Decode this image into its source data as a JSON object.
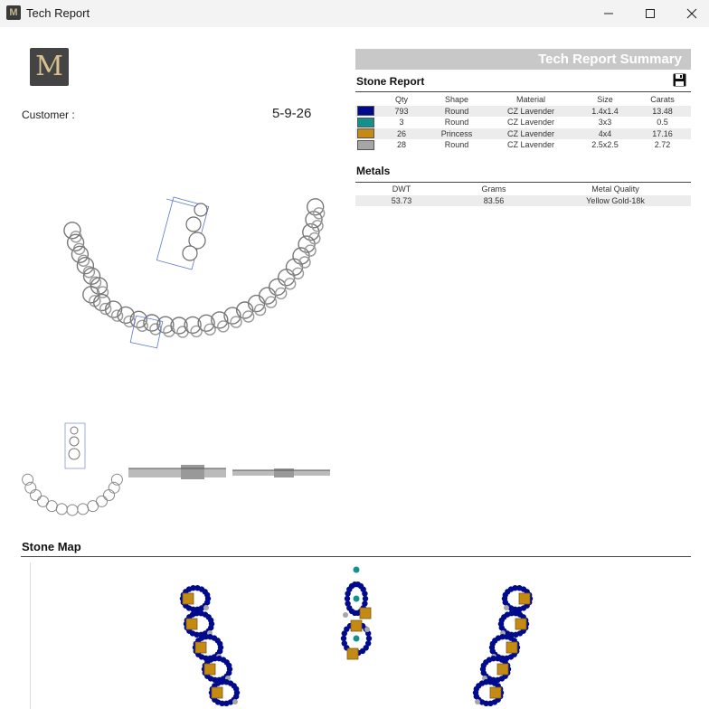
{
  "window": {
    "title": "Tech Report",
    "icon": "app-logo-icon",
    "controls": [
      "minimize-icon",
      "maximize-icon",
      "close-icon"
    ]
  },
  "header": {
    "logo_letter": "M",
    "customer_label": "Customer :",
    "date": "5-9-26"
  },
  "summary": {
    "title": "Tech Report Summary",
    "stone_report": {
      "heading": "Stone Report",
      "save_icon": "save-icon",
      "columns": [
        "Qty",
        "Shape",
        "Material",
        "Size",
        "Carats"
      ],
      "rows": [
        {
          "color": "#000a8c",
          "qty": "793",
          "shape": "Round",
          "material": "CZ Lavender",
          "size": "1.4x1.4",
          "carats": "13.48"
        },
        {
          "color": "#14918c",
          "qty": "3",
          "shape": "Round",
          "material": "CZ Lavender",
          "size": "3x3",
          "carats": "0.5"
        },
        {
          "color": "#c48a14",
          "qty": "26",
          "shape": "Princess",
          "material": "CZ Lavender",
          "size": "4x4",
          "carats": "17.16"
        },
        {
          "color": "#a6a6a6",
          "qty": "28",
          "shape": "Round",
          "material": "CZ Lavender",
          "size": "2.5x2.5",
          "carats": "2.72"
        }
      ]
    },
    "metals": {
      "heading": "Metals",
      "columns": [
        "DWT",
        "Grams",
        "Metal Quality"
      ],
      "rows": [
        {
          "dwt": "53.73",
          "grams": "83.56",
          "quality": "Yellow Gold-18k"
        }
      ]
    }
  },
  "stone_map": {
    "heading": "Stone Map"
  }
}
